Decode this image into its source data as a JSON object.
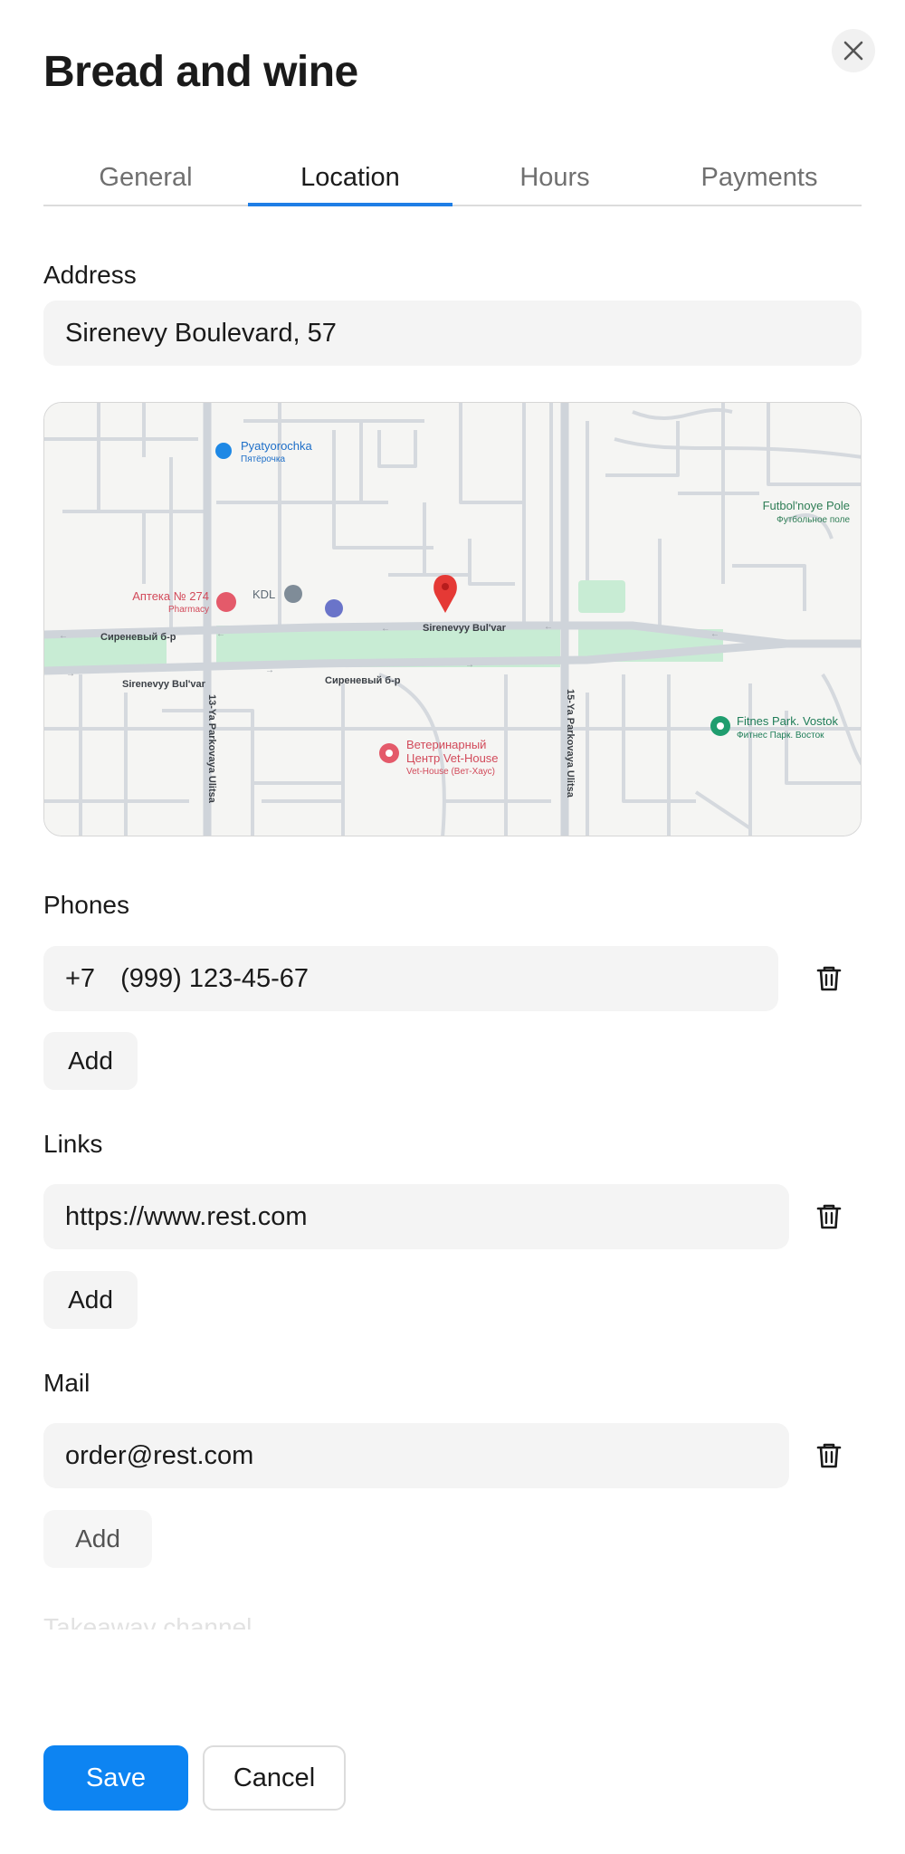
{
  "dialog": {
    "title": "Bread and wine",
    "close_icon": "close-icon"
  },
  "tabs": [
    {
      "label": "General",
      "active": false
    },
    {
      "label": "Location",
      "active": true
    },
    {
      "label": "Hours",
      "active": false
    },
    {
      "label": "Payments",
      "active": false
    }
  ],
  "address": {
    "label": "Address",
    "value": "Sirenevy Boulevard, 57"
  },
  "map": {
    "pois": {
      "shop_name": "Pyatyorochka",
      "shop_name_ru": "Пятёрочка",
      "field_name": "Futbol'noye Pole",
      "field_name_ru": "Футбольное поле",
      "pharmacy_name": "Аптека № 274",
      "pharmacy_type": "Pharmacy",
      "lab_name": "KDL",
      "vet_line1": "Ветеринарный",
      "vet_line2": "Центр Vet-House",
      "vet_line3": "Vet-House (Вет-Хаус)",
      "fitness_name": "Fitnes Park. Vostok",
      "fitness_name_ru": "Фитнес Парк. Восток"
    },
    "streets": {
      "boulevard_upper_ru": "Сиреневый б-р",
      "boulevard_upper_en": "Sirenevyy Bul'var",
      "boulevard_lower_en": "Sirenevyy Bul'var",
      "boulevard_lower_ru": "Сиреневый б-р",
      "street_13": "13-Ya Parkovaya Ulitsa",
      "street_15": "15-Ya Parkovaya Ulitsa"
    },
    "colors": {
      "pin": "#e53935",
      "park": "#c8ecd4",
      "road": "#d5d9de"
    }
  },
  "phones": {
    "label": "Phones",
    "code": "+7",
    "number": "(999) 123-45-67",
    "add_label": "Add"
  },
  "links": {
    "label": "Links",
    "value": "https://www.rest.com",
    "add_label": "Add"
  },
  "mail": {
    "label": "Mail",
    "value": "order@rest.com",
    "add_label": "Add"
  },
  "next_section": {
    "label": "Takeaway channel"
  },
  "footer": {
    "save_label": "Save",
    "cancel_label": "Cancel",
    "accent": "#0d84f2"
  }
}
